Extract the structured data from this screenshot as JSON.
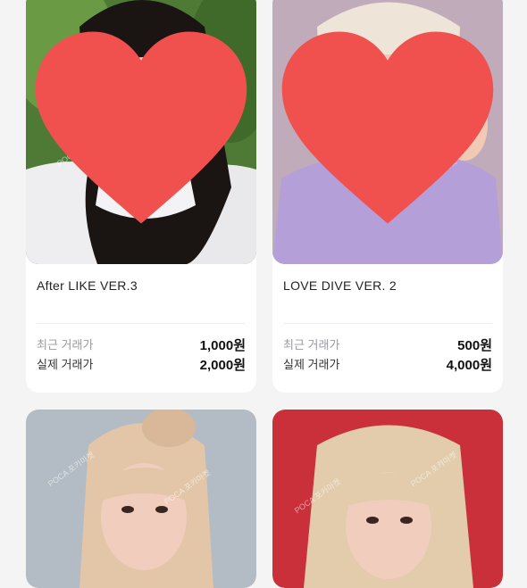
{
  "cards": [
    {
      "title": "After LIKE VER.3",
      "recent_label": "최근 거래가",
      "recent_price": "1,000원",
      "actual_label": "실제 거래가",
      "actual_price": "2,000원",
      "liked": true
    },
    {
      "title": "LOVE DIVE VER. 2",
      "recent_label": "최근 거래가",
      "recent_price": "500원",
      "actual_label": "실제 거래가",
      "actual_price": "4,000원",
      "liked": true
    },
    {
      "title": ""
    },
    {
      "title": ""
    }
  ],
  "icons": {
    "like": "heart-icon"
  },
  "colors": {
    "heart": "#f0514f",
    "card_bg": "#ffffff",
    "page_bg": "#f4f4f5"
  }
}
